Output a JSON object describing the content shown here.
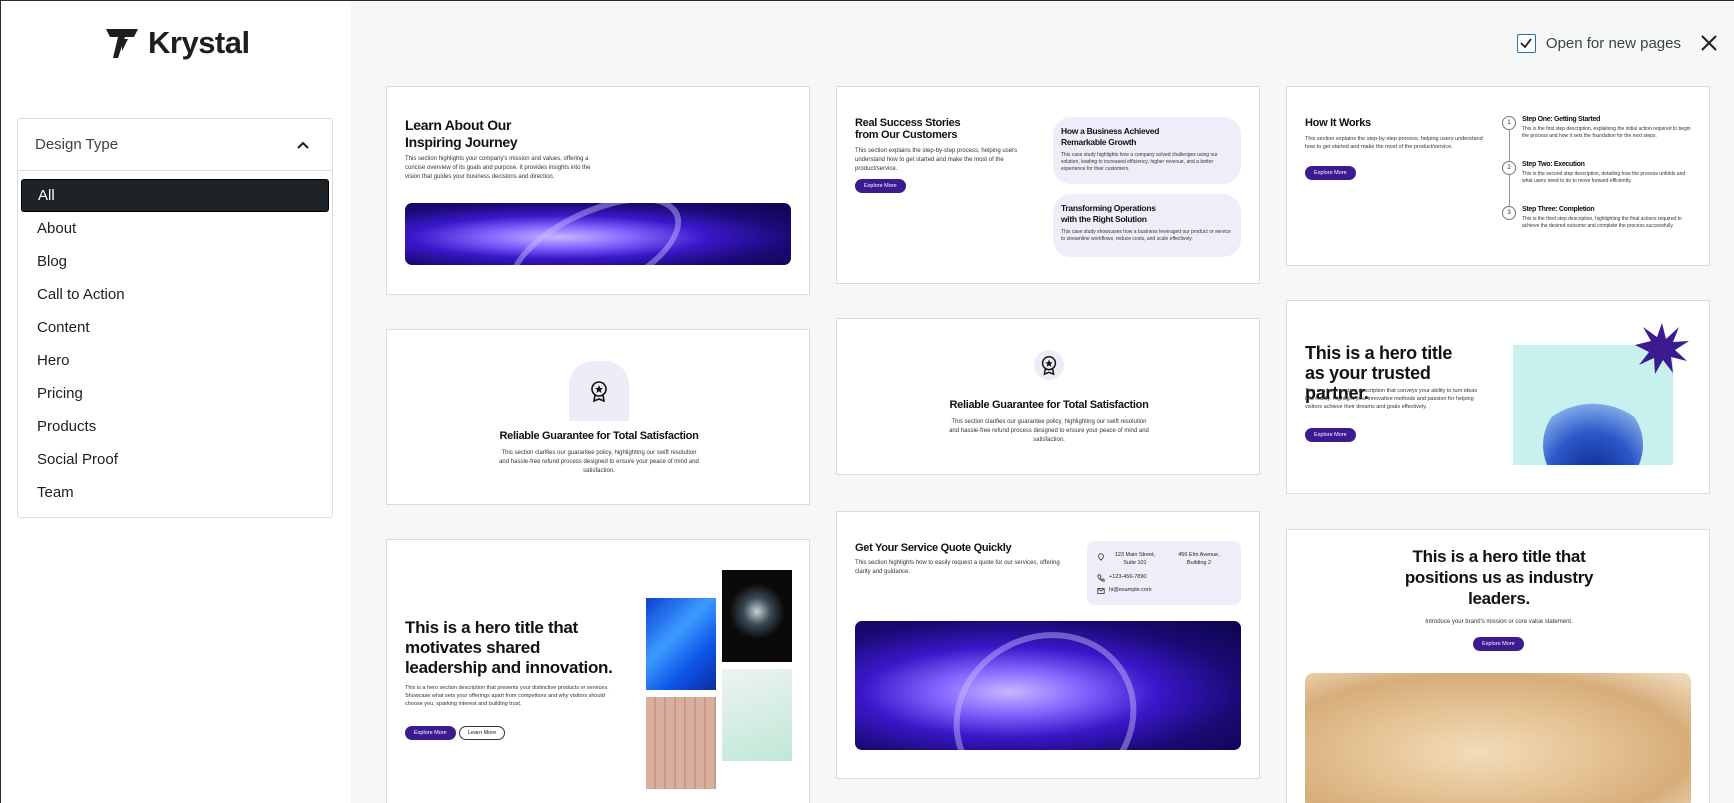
{
  "brand": {
    "name": "Krystal"
  },
  "filter": {
    "title": "Design Type",
    "items": [
      "All",
      "About",
      "Blog",
      "Call to Action",
      "Content",
      "Hero",
      "Pricing",
      "Products",
      "Social Proof",
      "Team"
    ],
    "selected": "All"
  },
  "topbar": {
    "checkbox_label": "Open for new pages",
    "checked": true
  },
  "cards": {
    "c1": {
      "title": "Learn About Our Inspiring Journey",
      "desc": "This section highlights your company's mission and values, offering a concise overview of its goals and purpose. It provides insights into the vision that guides your business decisions and direction."
    },
    "c2": {
      "title": "Real Success Stories from Our Customers",
      "desc": "This section explains the step-by-step process, helping users understand how to get started and make the most of the product/service.",
      "btn": "Explore More",
      "case1_title": "How a Business Achieved Remarkable Growth",
      "case1_desc": "This case study highlights how a company solved challenges using our solution, leading to increased efficiency, higher revenue, and a better experience for their customers.",
      "case2_title": "Transforming Operations with the Right Solution",
      "case2_desc": "This case study showcases how a business leveraged our product or service to streamline workflows, reduce costs, and scale effectively."
    },
    "c3": {
      "title": "How It Works",
      "desc": "This section explains the step-by-step process, helping users understand how to get started and make the most of the product/service.",
      "btn": "Explore More",
      "s1n": "1",
      "s1t": "Step One: Getting Started",
      "s1d": "This is the first step description, explaining the initial action required to begin the process and how it sets the foundation for the next steps.",
      "s2n": "2",
      "s2t": "Step Two: Execution",
      "s2d": "This is the second step description, detailing how the process unfolds and what users need to do to move forward efficiently.",
      "s3n": "3",
      "s3t": "Step Three: Completion",
      "s3d": "This is the third step description, highlighting the final actions required to achieve the desired outcome and complete the process successfully."
    },
    "c4": {
      "title": "Reliable Guarantee for Total Satisfaction",
      "desc": "This section clarifies our guarantee policy, highlighting our swift resolution and hassle-free refund process designed to ensure your peace of mind and satisfaction."
    },
    "c5": {
      "title": "Reliable Guarantee for Total Satisfaction",
      "desc": "This section clarifies our guarantee policy, highlighting our swift resolution and hassle-free refund process designed to ensure your peace of mind and satisfaction."
    },
    "c6": {
      "title": "This is a hero title as your trusted partner.",
      "desc": "This is a hero section description that conveys your ability to turn ideas into reality. Highlight your innovative methods and passion for helping visitors achieve their dreams and goals effectively.",
      "btn": "Explore More"
    },
    "c7": {
      "title": "This is a hero title that motivates shared leadership and innovation.",
      "desc": "This is a hero section description that presents your distinctive products or services. Showcase what sets your offerings apart from competitors and why visitors should choose you, sparking interest and building trust.",
      "btn1": "Explore More",
      "btn2": "Learn More"
    },
    "c8": {
      "title": "Get Your Service Quote Quickly",
      "desc": "This section highlights how to easily request a quote for our services, offering clarity and guidance.",
      "addr1": "123 Main Street, Suite 101",
      "addr2": "456 Elm Avenue, Building 2",
      "phone": "+123-456-7890",
      "email": "hi@example.com"
    },
    "c9": {
      "title": "This is a hero title that positions us as industry leaders.",
      "desc": "Introduce your brand's mission or core value statement.",
      "btn": "Explore More"
    }
  },
  "icons": [
    "logo-icon",
    "chevron-up-icon",
    "close-icon",
    "check-icon",
    "award-icon",
    "location-icon",
    "phone-icon",
    "mail-icon"
  ],
  "colors": {
    "accent": "#3b1b8f",
    "selected_bg": "#1d2327",
    "checkbox": "#2271b1"
  }
}
